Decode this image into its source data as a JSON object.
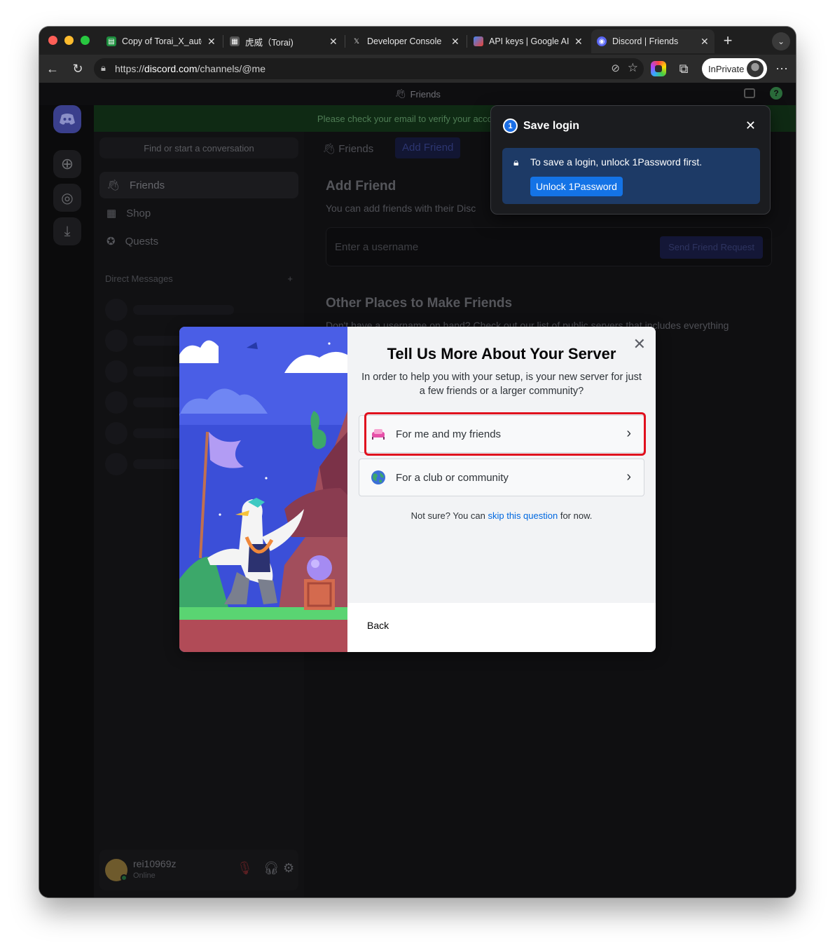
{
  "browser": {
    "tabs": [
      {
        "label": "Copy of Torai_X_auto",
        "favicon": "sheets-icon",
        "active": false
      },
      {
        "label": "虎威（Torai)",
        "favicon": "torai-icon",
        "active": false
      },
      {
        "label": "Developer Console",
        "favicon": "x-logo-icon",
        "active": false
      },
      {
        "label": "API keys | Google AI",
        "favicon": "google-ai-icon",
        "active": false
      },
      {
        "label": "Discord | Friends",
        "favicon": "discord-icon",
        "active": true
      }
    ],
    "url_prefix": "https://",
    "url_domain": "discord.com",
    "url_path": "/channels/@me",
    "profile_label": "InPrivate"
  },
  "discord": {
    "title": "Friends",
    "banner": "Please check your email to verify your account and keep your c",
    "search_placeholder": "Find or start a conversation",
    "nav": [
      {
        "label": "Friends",
        "icon": "friends-icon"
      },
      {
        "label": "Shop",
        "icon": "shop-icon"
      },
      {
        "label": "Quests",
        "icon": "quests-icon"
      }
    ],
    "direct_messages": "Direct Messages",
    "dm_add": "+",
    "header_friends": "Friends",
    "header_add_friend": "Add Friend",
    "add_friend_title": "Add Friend",
    "add_friend_desc": "You can add friends with their Disc",
    "username_placeholder": "Enter a username",
    "send_request": "Send Friend Request",
    "other_places_title": "Other Places to Make Friends",
    "other_places_desc": "Don't have a username on hand? Check out our list of public servers that includes everything",
    "user": {
      "name": "rei10969z",
      "status": "Online"
    }
  },
  "onepassword": {
    "title": "Save login",
    "message": "To save a login, unlock 1Password first.",
    "button": "Unlock 1Password",
    "close": "✕"
  },
  "modal": {
    "title": "Tell Us More About Your Server",
    "subtitle": "In order to help you with your setup, is your new server for just a few friends or a larger community?",
    "options": [
      {
        "label": "For me and my friends",
        "icon": "friends-couch-icon"
      },
      {
        "label": "For a club or community",
        "icon": "globe-icon"
      }
    ],
    "note_prefix": "Not sure? You can ",
    "note_link": "skip this question",
    "note_suffix": " for now.",
    "back": "Back",
    "close": "✕"
  },
  "colors": {
    "highlight": "#e0101e",
    "link": "#0068e0",
    "onepassword_button": "#1473e6",
    "discord_blurple": "#5865f2"
  }
}
